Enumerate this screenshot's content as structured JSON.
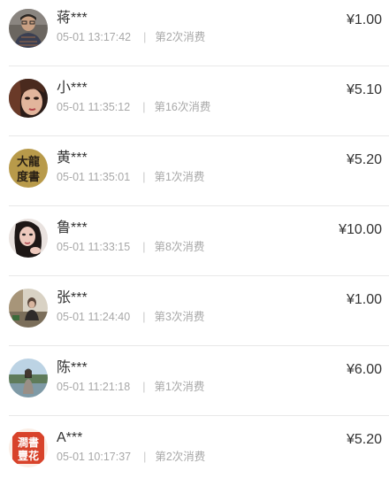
{
  "records": [
    {
      "name": "蒋***",
      "time": "05-01 13:17:42",
      "separator": "|",
      "count": "第2次消费",
      "amount": "¥1.00",
      "avatar": "avatar-man-glasses"
    },
    {
      "name": "小***",
      "time": "05-01 11:35:12",
      "separator": "|",
      "count": "第16次消费",
      "amount": "¥5.10",
      "avatar": "avatar-woman-face"
    },
    {
      "name": "黄***",
      "time": "05-01 11:35:01",
      "separator": "|",
      "count": "第1次消费",
      "amount": "¥5.20",
      "avatar": "avatar-calligraphy"
    },
    {
      "name": "鲁***",
      "time": "05-01 11:33:15",
      "separator": "|",
      "count": "第8次消费",
      "amount": "¥10.00",
      "avatar": "avatar-woman-portrait"
    },
    {
      "name": "张***",
      "time": "05-01 11:24:40",
      "separator": "|",
      "count": "第3次消费",
      "amount": "¥1.00",
      "avatar": "avatar-room-scene"
    },
    {
      "name": "陈***",
      "time": "05-01 11:21:18",
      "separator": "|",
      "count": "第1次消费",
      "amount": "¥6.00",
      "avatar": "avatar-outdoor-lake"
    },
    {
      "name": "A***",
      "time": "05-01 10:17:37",
      "separator": "|",
      "count": "第2次消费",
      "amount": "¥5.20",
      "avatar": "avatar-red-seal"
    }
  ],
  "avatar_text": {
    "calligraphy": "大龍 度書",
    "seal": "澗書 豐花"
  },
  "colors": {
    "text": "#333333",
    "meta": "#a8a8a8",
    "divider": "#e8e8e8",
    "seal_red": "#d8432b",
    "calligraphy_gold": "#b89a4a"
  }
}
